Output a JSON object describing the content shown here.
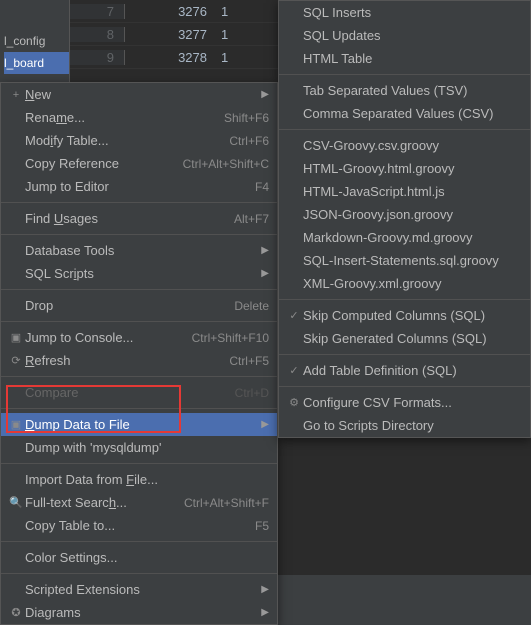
{
  "background": {
    "sidebar_items": [
      {
        "label": "l_config"
      },
      {
        "label": "l_board"
      }
    ],
    "rows": [
      {
        "num": "7",
        "a": "3276",
        "b": "1"
      },
      {
        "num": "8",
        "a": "3277",
        "b": "1"
      },
      {
        "num": "9",
        "a": "3278",
        "b": "1"
      }
    ]
  },
  "menu": {
    "items": [
      {
        "icon": "+",
        "label_parts": [
          "",
          "N",
          "ew"
        ],
        "shortcut": "",
        "arrow": true
      },
      {
        "icon": "",
        "label_parts": [
          "Rena",
          "m",
          "e..."
        ],
        "shortcut": "Shift+F6"
      },
      {
        "icon": "",
        "label_parts": [
          "Mod",
          "i",
          "fy Table..."
        ],
        "shortcut": "Ctrl+F6"
      },
      {
        "icon": "",
        "label_parts": [
          "Copy Reference"
        ],
        "shortcut": "Ctrl+Alt+Shift+C"
      },
      {
        "icon": "",
        "label_parts": [
          "Jump to Editor"
        ],
        "shortcut": "F4"
      },
      {
        "sep": true
      },
      {
        "icon": "",
        "label_parts": [
          "Find ",
          "U",
          "sages"
        ],
        "shortcut": "Alt+F7"
      },
      {
        "sep": true
      },
      {
        "icon": "",
        "label_parts": [
          "Database Tools"
        ],
        "arrow": true
      },
      {
        "icon": "",
        "label_parts": [
          "SQL Scr",
          "i",
          "pts"
        ],
        "arrow": true
      },
      {
        "sep": true
      },
      {
        "icon": "",
        "label_parts": [
          "Drop"
        ],
        "shortcut": "Delete"
      },
      {
        "sep": true
      },
      {
        "icon": "▣",
        "label_parts": [
          "Jump to Console..."
        ],
        "shortcut": "Ctrl+Shift+F10"
      },
      {
        "icon": "⟳",
        "label_parts": [
          "",
          "R",
          "efresh"
        ],
        "shortcut": "Ctrl+F5"
      },
      {
        "sep": true
      },
      {
        "icon": "",
        "label_parts": [
          "Compare"
        ],
        "shortcut": "Ctrl+D",
        "disabled": true
      },
      {
        "sep": true
      },
      {
        "icon": "▣",
        "label_parts": [
          "",
          "D",
          "ump Data to File"
        ],
        "arrow": true,
        "highlighted": true
      },
      {
        "icon": "",
        "label_parts": [
          "Dump with 'mysqldump'"
        ]
      },
      {
        "sep": true
      },
      {
        "icon": "",
        "label_parts": [
          "Import Data from ",
          "F",
          "ile..."
        ]
      },
      {
        "icon": "🔍",
        "label_parts": [
          "Full-text Searc",
          "h",
          "..."
        ],
        "shortcut": "Ctrl+Alt+Shift+F"
      },
      {
        "icon": "",
        "label_parts": [
          "Copy Table to..."
        ],
        "shortcut": "F5"
      },
      {
        "sep": true
      },
      {
        "icon": "",
        "label_parts": [
          "Color Settings..."
        ]
      },
      {
        "sep": true
      },
      {
        "icon": "",
        "label_parts": [
          "Scripted Extensions"
        ],
        "arrow": true
      },
      {
        "icon": "✪",
        "label_parts": [
          "Dia",
          "g",
          "rams"
        ],
        "arrow": true
      }
    ]
  },
  "submenu": {
    "items": [
      {
        "label": "SQL Inserts"
      },
      {
        "label": "SQL Updates"
      },
      {
        "label": "HTML Table"
      },
      {
        "sep": true
      },
      {
        "label": "Tab Separated Values (TSV)"
      },
      {
        "label": "Comma Separated Values (CSV)"
      },
      {
        "sep": true
      },
      {
        "label": "CSV-Groovy.csv.groovy"
      },
      {
        "label": "HTML-Groovy.html.groovy"
      },
      {
        "label": "HTML-JavaScript.html.js"
      },
      {
        "label": "JSON-Groovy.json.groovy"
      },
      {
        "label": "Markdown-Groovy.md.groovy"
      },
      {
        "label": "SQL-Insert-Statements.sql.groovy"
      },
      {
        "label": "XML-Groovy.xml.groovy"
      },
      {
        "sep": true
      },
      {
        "label": "Skip Computed Columns (SQL)",
        "check": true
      },
      {
        "label": "Skip Generated Columns (SQL)"
      },
      {
        "sep": true
      },
      {
        "label": "Add Table Definition (SQL)",
        "check": true
      },
      {
        "sep": true
      },
      {
        "label": "Configure CSV Formats...",
        "icon": "⚙"
      },
      {
        "label": "Go to Scripts Directory"
      }
    ]
  }
}
